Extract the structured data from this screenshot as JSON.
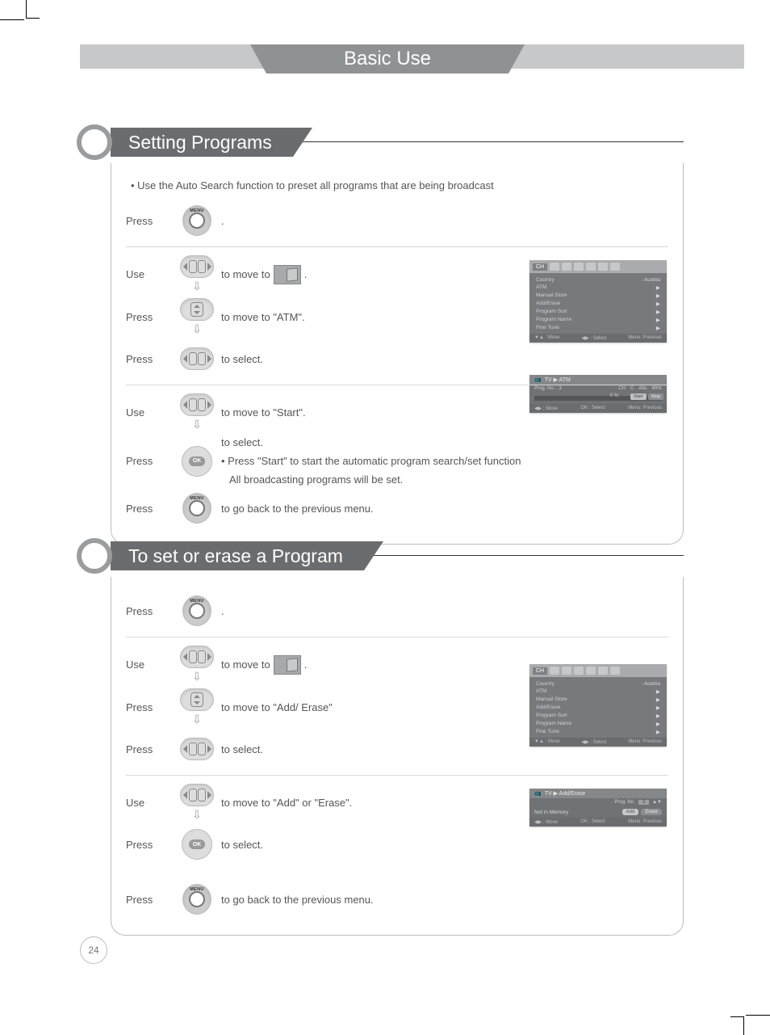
{
  "header": {
    "title": "Basic Use"
  },
  "page_number": "24",
  "sections": [
    {
      "title": "Setting Programs",
      "intro": "• Use the Auto Search function to preset all programs that are being broadcast",
      "steps": [
        {
          "verb": "Press",
          "icon": "menu-button",
          "desc": "."
        },
        {
          "verb": "Use",
          "icon": "left-right-button",
          "desc_pre": "to move to",
          "desc_post": ".",
          "thumb": true,
          "arrow_below": true
        },
        {
          "verb": "Press",
          "icon": "up-down-button",
          "desc": "to move to \"ATM\".",
          "arrow_below": true
        },
        {
          "verb": "Press",
          "icon": "left-right-button",
          "desc": "to select.",
          "sep": true
        },
        {
          "verb": "Use",
          "icon": "left-right-button",
          "desc": "to move to \"Start\".",
          "arrow_below": true
        },
        {
          "verb": "Press",
          "icon": "ok-button",
          "desc": "to select.",
          "sub1": "• Press \"Start\" to start the automatic program search/set function",
          "sub2": "All broadcasting programs will be set."
        },
        {
          "verb": "Press",
          "icon": "menu-button",
          "desc": "to go back to the previous menu."
        }
      ],
      "osd1": {
        "tab": "CH",
        "items": [
          {
            "k": "Country",
            "v": ": Austria"
          },
          {
            "k": "ATM",
            "v": ": ▶"
          },
          {
            "k": "Manual Store",
            "v": ": ▶"
          },
          {
            "k": "Add/Erase",
            "v": ": ▶"
          },
          {
            "k": "Program Sort",
            "v": ": ▶"
          },
          {
            "k": "Program Name",
            "v": ": ▶"
          },
          {
            "k": "Fine Tune",
            "v": ": ▶"
          }
        ],
        "footer": {
          "l": "▼▲ : Move",
          "m": "◀▶ : Select",
          "r": "Menu: Previous"
        }
      },
      "osd2": {
        "crumb": "TV ▶ ATM",
        "line": {
          "label": "Prog. No. : 3",
          "ch": "CH",
          "c": "C",
          "abc": "Abc",
          "mhz": "MHz"
        },
        "pct": "0 %",
        "start": "Start",
        "stop": "Stop",
        "footer": {
          "l": "◀▶ : Move",
          "m": "OK : Select",
          "r": "Menu: Previous"
        }
      }
    },
    {
      "title": "To set or erase a Program",
      "steps": [
        {
          "verb": "Press",
          "icon": "menu-button",
          "desc": "."
        },
        {
          "verb": "Use",
          "icon": "left-right-button",
          "desc_pre": "to move to",
          "desc_post": ".",
          "thumb": true,
          "arrow_below": true
        },
        {
          "verb": "Press",
          "icon": "up-down-button",
          "desc": "to move to \"Add/ Erase\"",
          "arrow_below": true
        },
        {
          "verb": "Press",
          "icon": "left-right-button",
          "desc": "to select.",
          "sep": true
        },
        {
          "verb": "Use",
          "icon": "left-right-button",
          "desc": "to move to  \"Add\" or \"Erase\".",
          "arrow_below": true
        },
        {
          "verb": "Press",
          "icon": "ok-button",
          "desc": "to select."
        },
        {
          "verb": "Press",
          "icon": "menu-button",
          "desc": "to go back to the previous menu."
        }
      ],
      "osd1": {
        "tab": "CH",
        "items": [
          {
            "k": "Country",
            "v": ": Austria"
          },
          {
            "k": "ATM",
            "v": ": ▶"
          },
          {
            "k": "Manual Store",
            "v": ": ▶"
          },
          {
            "k": "Add/Erase",
            "v": ": ▶"
          },
          {
            "k": "Program Sort",
            "v": ": ▶"
          },
          {
            "k": "Program Name",
            "v": ": ▶"
          },
          {
            "k": "Fine Tune",
            "v": ": ▶"
          }
        ],
        "footer": {
          "l": "▼▲ : Move",
          "m": "◀▶ : Select",
          "r": "Menu: Previous"
        }
      },
      "osd2": {
        "crumb": "TV ▶ Add/Erase",
        "prog_label": "Prog. No.",
        "prog_val": "3",
        "status": "Not in Memory",
        "add": "Add",
        "erase": "Erase",
        "footer": {
          "l": "◀▶ : Move",
          "m": "OK : Select",
          "r": "Menu: Previous"
        }
      }
    }
  ],
  "icons": {
    "menu_label": "MENU",
    "ok_label": "OK"
  }
}
